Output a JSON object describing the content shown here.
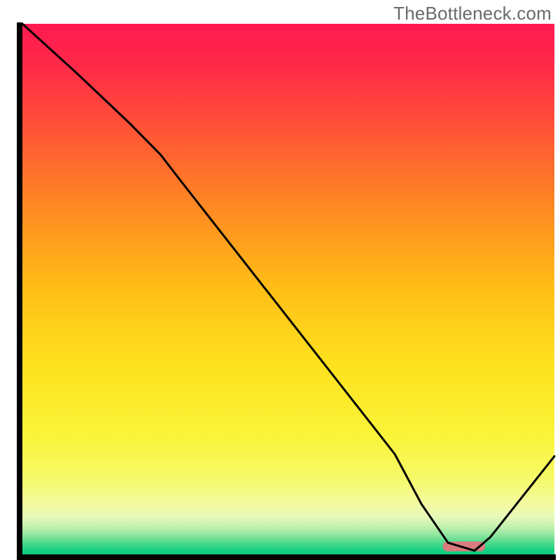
{
  "watermark": "TheBottleneck.com",
  "chart_data": {
    "type": "line",
    "title": "",
    "xlabel": "",
    "ylabel": "",
    "xlim": [
      0,
      100
    ],
    "ylim": [
      0,
      100
    ],
    "grid": false,
    "legend": false,
    "series": [
      {
        "name": "curve",
        "x": [
          0,
          10,
          20,
          26,
          30,
          40,
          50,
          60,
          70,
          75,
          80,
          85,
          88,
          100
        ],
        "y": [
          100,
          90.9,
          81.4,
          75.3,
          70.1,
          57.3,
          44.5,
          31.7,
          18.9,
          9.5,
          2.2,
          0.7,
          3.3,
          18.5
        ]
      }
    ],
    "marker": {
      "name": "optimal-zone",
      "x_start": 79,
      "x_end": 87,
      "y": 1.5,
      "color": "#d97b7f"
    },
    "background_gradient": {
      "stops": [
        {
          "offset": 0.0,
          "color": "#ff1950"
        },
        {
          "offset": 0.08,
          "color": "#ff2a49"
        },
        {
          "offset": 0.2,
          "color": "#ff5436"
        },
        {
          "offset": 0.35,
          "color": "#ff8a22"
        },
        {
          "offset": 0.5,
          "color": "#ffbf16"
        },
        {
          "offset": 0.65,
          "color": "#fde31f"
        },
        {
          "offset": 0.78,
          "color": "#faf43a"
        },
        {
          "offset": 0.86,
          "color": "#f6fa6b"
        },
        {
          "offset": 0.905,
          "color": "#f3fba0"
        },
        {
          "offset": 0.928,
          "color": "#e8f9b9"
        },
        {
          "offset": 0.946,
          "color": "#c7f2b0"
        },
        {
          "offset": 0.962,
          "color": "#95e8a0"
        },
        {
          "offset": 0.978,
          "color": "#4ed98c"
        },
        {
          "offset": 0.992,
          "color": "#16cf7f"
        },
        {
          "offset": 1.0,
          "color": "#0bcb7a"
        }
      ]
    },
    "axes_color": "#000000",
    "curve_color": "#000000"
  }
}
